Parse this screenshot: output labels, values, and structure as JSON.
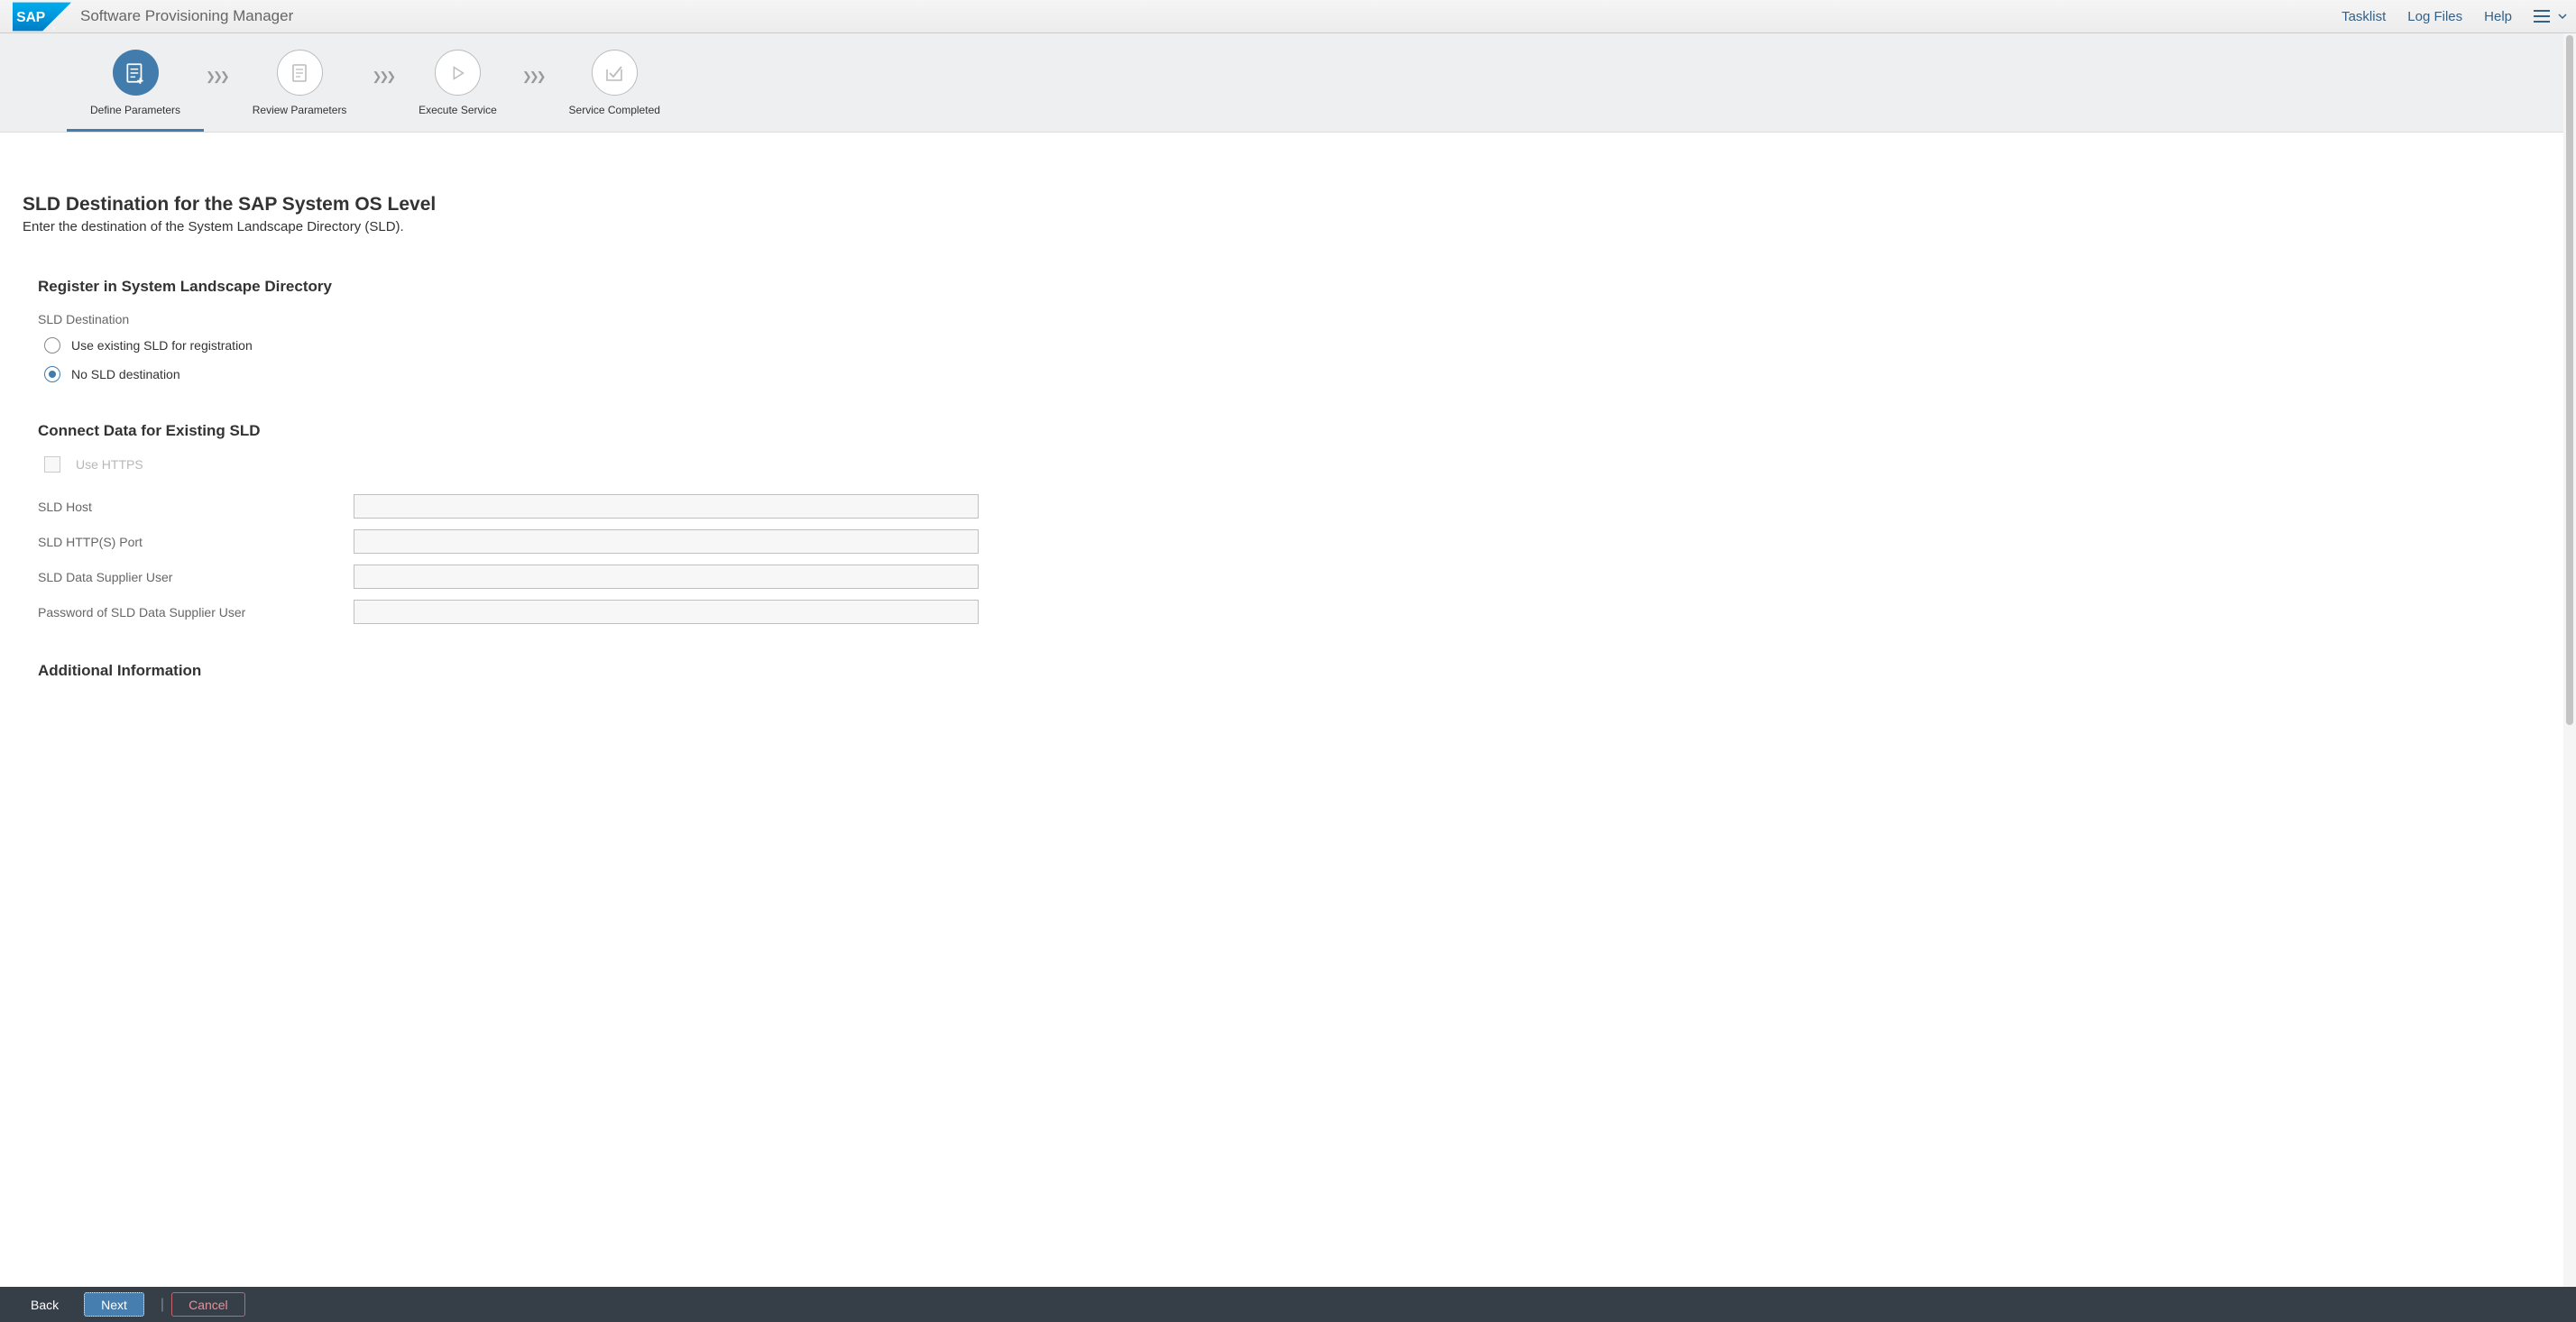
{
  "header": {
    "app_title": "Software Provisioning Manager",
    "links": {
      "tasklist": "Tasklist",
      "log_files": "Log Files",
      "help": "Help"
    }
  },
  "stepper": {
    "step1": "Define Parameters",
    "step2": "Review Parameters",
    "step3": "Execute Service",
    "step4": "Service Completed"
  },
  "page": {
    "title": "SLD Destination for the SAP System OS Level",
    "subtitle": "Enter the destination of the System Landscape Directory (SLD)."
  },
  "section1": {
    "title": "Register in System Landscape Directory",
    "dest_label": "SLD Destination",
    "radio1": "Use existing SLD for registration",
    "radio2": "No SLD destination"
  },
  "section2": {
    "title": "Connect Data for Existing SLD",
    "use_https": "Use HTTPS",
    "host_label": "SLD Host",
    "port_label": "SLD HTTP(S) Port",
    "user_label": "SLD Data Supplier User",
    "pass_label": "Password of SLD Data Supplier User",
    "host_value": "",
    "port_value": "",
    "user_value": "",
    "pass_value": ""
  },
  "section3": {
    "title": "Additional Information"
  },
  "footer": {
    "back": "Back",
    "next": "Next",
    "cancel": "Cancel"
  }
}
